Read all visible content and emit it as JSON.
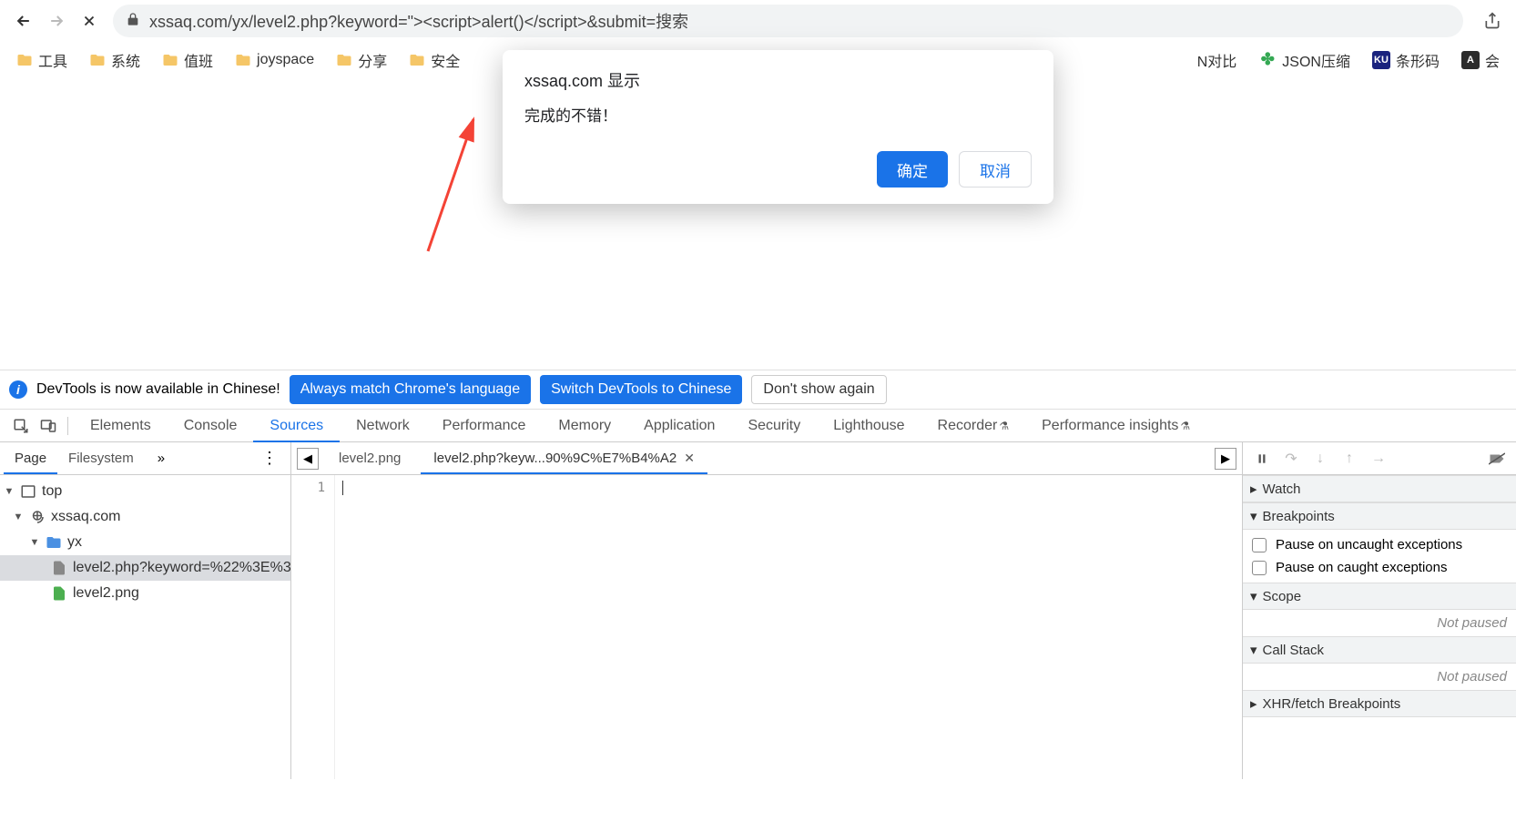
{
  "url": "xssaq.com/yx/level2.php?keyword=\"><script>alert()</script>&submit=搜索",
  "bookmarks": {
    "left": [
      "工具",
      "系统",
      "值班",
      "joyspace",
      "分享",
      "安全"
    ],
    "right": [
      {
        "icon": "text",
        "label": "N对比"
      },
      {
        "icon": "flower",
        "label": "JSON压缩",
        "color": "#34a853"
      },
      {
        "icon": "ku",
        "label": "条形码",
        "bg": "#1a237e"
      },
      {
        "icon": "a",
        "label": "会",
        "bg": "#2c2c2c"
      }
    ]
  },
  "dialog": {
    "title": "xssaq.com 显示",
    "message": "完成的不错！",
    "ok": "确定",
    "cancel": "取消"
  },
  "devtools_notice": {
    "text": "DevTools is now available in Chinese!",
    "btn1": "Always match Chrome's language",
    "btn2": "Switch DevTools to Chinese",
    "btn3": "Don't show again"
  },
  "devtools_tabs": [
    "Elements",
    "Console",
    "Sources",
    "Network",
    "Performance",
    "Memory",
    "Application",
    "Security",
    "Lighthouse",
    "Recorder",
    "Performance insights"
  ],
  "page_tabs": {
    "page": "Page",
    "filesystem": "Filesystem"
  },
  "tree": {
    "top": "top",
    "domain": "xssaq.com",
    "folder": "yx",
    "file_php": "level2.php?keyword=%22%3E%3",
    "file_png": "level2.png"
  },
  "editor": {
    "tab1": "level2.png",
    "tab2": "level2.php?keyw...90%9C%E7%B4%A2",
    "line1": "1"
  },
  "debug": {
    "watch": "Watch",
    "breakpoints": "Breakpoints",
    "pause_uncaught": "Pause on uncaught exceptions",
    "pause_caught": "Pause on caught exceptions",
    "scope": "Scope",
    "not_paused": "Not paused",
    "call_stack": "Call Stack",
    "xhr": "XHR/fetch Breakpoints"
  }
}
